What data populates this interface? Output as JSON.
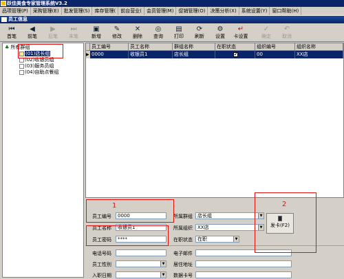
{
  "window": {
    "title": "跃佳美食专家管理系统V3.2"
  },
  "menu": [
    "品项管理(P)",
    "采购管理(E)",
    "批发管理(S)",
    "库存管理(",
    "前台营业(",
    "会员管理(M)",
    "促销管理(O)",
    "决策分析(X)",
    "系统设置(Y)",
    "窗口帮助(H)"
  ],
  "subwindow": {
    "title": "员工信息"
  },
  "toolbar": {
    "first": "首笔",
    "prev": "前笔",
    "next": "后笔",
    "last": "末笔",
    "add": "新增",
    "edit": "修改",
    "delete": "删除",
    "query": "查询",
    "print": "打印",
    "refresh": "刷新",
    "settings": "设置",
    "card_settings": "卡设置",
    "confirm": "确定",
    "cancel": "取消"
  },
  "tree": {
    "root": "所有群组",
    "groups": [
      "(01)店长组",
      "(02)收银员组",
      "(03)服务员组",
      "(04)自助点餐组"
    ]
  },
  "grid": {
    "columns": [
      "员工编号",
      "员工名称",
      "群组名称",
      "在职状态",
      "组织编号",
      "组织名称"
    ],
    "rows": [
      {
        "id": "0000",
        "name": "收银员1",
        "group": "店长组",
        "active": "✔",
        "org_id": "00",
        "org_name": "XX店"
      }
    ]
  },
  "form": {
    "emp_id_label": "员工编号",
    "emp_id_value": "0000",
    "emp_name_label": "员工名称",
    "emp_name_value": "收银员1",
    "emp_pwd_label": "员工密码",
    "emp_pwd_value": "****",
    "group_label": "所属群组",
    "group_value": "店长组",
    "org_label": "所属组织",
    "org_value": "XX店",
    "status_label": "在职状态",
    "status_value": "在职",
    "phone_label": "电话号码",
    "email_label": "电子邮件",
    "gender_label": "员工性别",
    "address_label": "居住地址",
    "entry_label": "入职日期",
    "bank_label": "数据卡号",
    "card_button": "发卡(F2)"
  },
  "annotations": {
    "box1": "1",
    "box2": "2"
  },
  "colors": {
    "titlebar": "#0a246a",
    "selection": "#0a246a",
    "highlight": "#e01010",
    "face": "#d4d0c8"
  }
}
